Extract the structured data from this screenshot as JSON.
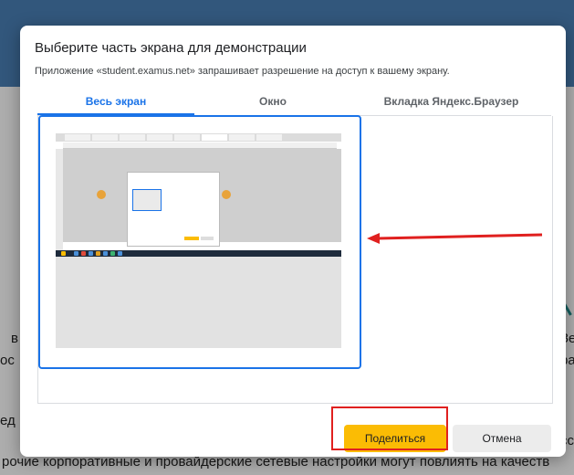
{
  "background": {
    "fragments": [
      {
        "text": "в",
        "name": "bg-text-v"
      },
      {
        "text": "ос",
        "name": "bg-text-os"
      },
      {
        "text": "Зе",
        "name": "bg-text-ze"
      },
      {
        "text": "ра",
        "name": "bg-text-ra"
      },
      {
        "text": "ед",
        "name": "bg-text-ed"
      },
      {
        "text": "сс",
        "name": "bg-text-ss"
      },
      {
        "text": "рочие корпоративные и провайдерские сетевые настройки могут повлиять на качеств",
        "name": "bg-bottom-line"
      }
    ]
  },
  "dialog": {
    "title": "Выберите часть экрана для демонстрации",
    "subtitle": "Приложение «student.examus.net» запрашивает разрешение на доступ к вашему экрану.",
    "tabs": [
      {
        "label": "Весь экран",
        "active": true
      },
      {
        "label": "Окно",
        "active": false
      },
      {
        "label": "Вкладка Яндекс.Браузер",
        "active": false
      }
    ],
    "buttons": {
      "share": "Поделиться",
      "cancel": "Отмена"
    }
  },
  "annotations": {
    "arrow_color": "#e0201f",
    "highlight_color": "#e0201f"
  },
  "colors": {
    "accent": "#1a73e8",
    "share_button": "#fbbc04",
    "cancel_button": "#ececec"
  }
}
